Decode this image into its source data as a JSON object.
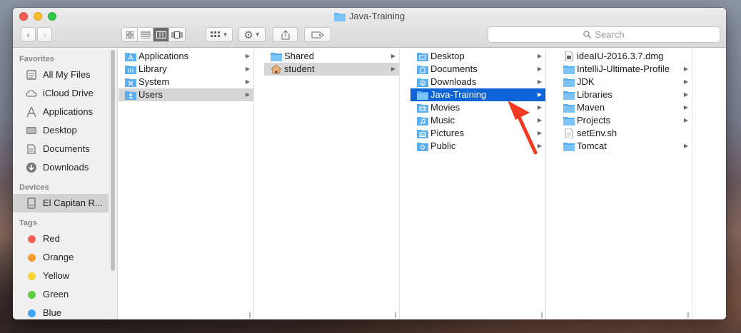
{
  "window": {
    "title": "Java-Training"
  },
  "toolbar": {
    "search_placeholder": "Search"
  },
  "sidebar": {
    "favorites_header": "Favorites",
    "favorites": [
      {
        "label": "All My Files",
        "icon": "all-files-icon"
      },
      {
        "label": "iCloud Drive",
        "icon": "cloud-icon"
      },
      {
        "label": "Applications",
        "icon": "applications-icon"
      },
      {
        "label": "Desktop",
        "icon": "desktop-icon"
      },
      {
        "label": "Documents",
        "icon": "documents-icon"
      },
      {
        "label": "Downloads",
        "icon": "downloads-icon"
      }
    ],
    "devices_header": "Devices",
    "devices": [
      {
        "label": "El Capitan R...",
        "icon": "disk-icon"
      }
    ],
    "tags_header": "Tags",
    "tags": [
      {
        "label": "Red",
        "color": "#fc5f57"
      },
      {
        "label": "Orange",
        "color": "#fd9a2e"
      },
      {
        "label": "Yellow",
        "color": "#fdd333"
      },
      {
        "label": "Green",
        "color": "#5ccd3f"
      },
      {
        "label": "Blue",
        "color": "#3ea4f5"
      }
    ]
  },
  "columns": {
    "root": [
      {
        "label": "Applications",
        "state": ""
      },
      {
        "label": "Library",
        "state": ""
      },
      {
        "label": "System",
        "state": ""
      },
      {
        "label": "Users",
        "state": "grey"
      }
    ],
    "users": [
      {
        "label": "Shared",
        "state": ""
      },
      {
        "label": "student",
        "state": "grey"
      }
    ],
    "student": [
      {
        "label": "Desktop",
        "state": ""
      },
      {
        "label": "Documents",
        "state": ""
      },
      {
        "label": "Downloads",
        "state": ""
      },
      {
        "label": "Java-Training",
        "state": "blue"
      },
      {
        "label": "Movies",
        "state": ""
      },
      {
        "label": "Music",
        "state": ""
      },
      {
        "label": "Pictures",
        "state": ""
      },
      {
        "label": "Public",
        "state": ""
      }
    ],
    "java_training": [
      {
        "label": "ideaIU-2016.3.7.dmg",
        "type": "file"
      },
      {
        "label": "IntelliJ-Ultimate-Profile",
        "type": "folder"
      },
      {
        "label": "JDK",
        "type": "folder"
      },
      {
        "label": "Libraries",
        "type": "folder"
      },
      {
        "label": "Maven",
        "type": "folder"
      },
      {
        "label": "Projects",
        "type": "folder"
      },
      {
        "label": "setEnv.sh",
        "type": "file"
      },
      {
        "label": "Tomcat",
        "type": "folder"
      }
    ]
  },
  "colors": {
    "selection": "#0e63d6",
    "folder": "#5aaff0",
    "annotation_arrow": "#f23a22"
  }
}
